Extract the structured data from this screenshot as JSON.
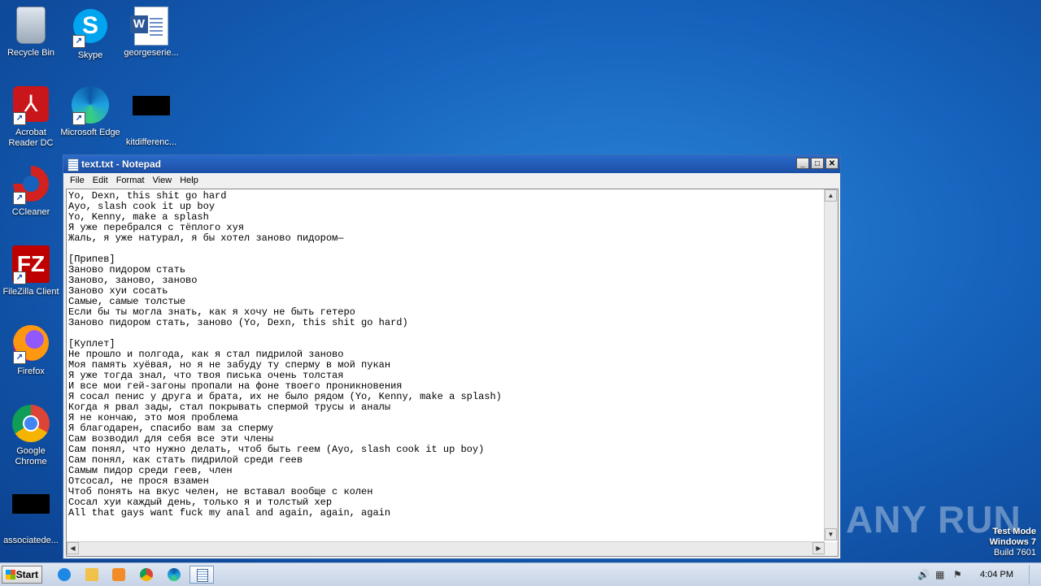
{
  "desktop": {
    "icons": [
      {
        "label": "Recycle Bin"
      },
      {
        "label": "Skype"
      },
      {
        "label": "georgeserie..."
      },
      {
        "label": "Acrobat Reader DC"
      },
      {
        "label": "Microsoft Edge"
      },
      {
        "label": "kitdifferenc..."
      },
      {
        "label": "CCleaner"
      },
      {
        "label": "FileZilla Client"
      },
      {
        "label": "Firefox"
      },
      {
        "label": "Google Chrome"
      },
      {
        "label": "associatede..."
      }
    ],
    "watermark": "ANY RUN",
    "test_mode": {
      "line1": "Test Mode",
      "line2": "Windows 7",
      "line3": "Build 7601"
    }
  },
  "notepad": {
    "title": "text.txt - Notepad",
    "menu": [
      "File",
      "Edit",
      "Format",
      "View",
      "Help"
    ],
    "content": "Yo, Dexn, this shit go hard\nAyo, slash cook it up boy\nYo, Kenny, make a splash\nЯ уже перебрался с тёплого хуя\nЖаль, я уже натурал, я бы хотел заново пидором—\n\n[Припев]\nЗаново пидором стать\nЗаново, заново, заново\nЗаново хуи сосать\nСамые, самые толстые\nЕсли бы ты могла знать, как я хочу не быть гетеро\nЗаново пидором стать, заново (Yo, Dexn, this shit go hard)\n\n[Куплет]\nНе прошло и полгода, как я стал пидрилой заново\nМоя память хуёвая, но я не забуду ту сперму в мой пукан\nЯ уже тогда знал, что твоя писька очень толстая\nИ все мои гей-загоны пропали на фоне твоего проникновения\nЯ сосал пенис у друга и брата, их не было рядом (Yo, Kenny, make a splash)\nКогда я рвал зады, стал покрывать спермой трусы и аналы\nЯ не кончаю, это моя проблема\nЯ благодарен, спасибо вам за сперму\nСам возводил для себя все эти члены\nСам понял, что нужно делать, чтоб быть геем (Ayo, slash cook it up boy)\nСам понял, как стать пидрилой среди геев\nСамым пидор среди геев, член\nОтсосал, не прося взамен\nЧтоб понять на вкус челен, не вставал вообще с колен\nСосал хуи каждый день, только я и толстый хер\nAll that gays want fuck my anal and again, again, again"
  },
  "taskbar": {
    "start_label": "Start",
    "clock": "4:04 PM"
  }
}
